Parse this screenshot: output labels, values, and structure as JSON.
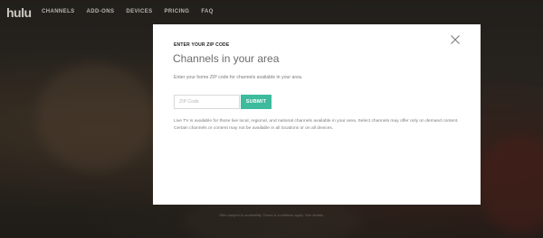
{
  "nav": {
    "logo": "hulu",
    "links": [
      "CHANNELS",
      "ADD-ONS",
      "DEVICES",
      "PRICING",
      "FAQ"
    ]
  },
  "modal": {
    "eyebrow": "ENTER YOUR ZIP CODE",
    "title": "Channels in your area",
    "subtitle": "Enter your home ZIP code for channels available in your area.",
    "zip_placeholder": "ZIP Code",
    "submit_label": "SUBMIT",
    "note": "Live TV is available for those live local, regional, and national channels available in your area. Select channels may offer only on demand content. Certain channels or content may not be available in all locations or on all devices.",
    "close_icon": "close-icon"
  },
  "footer": {
    "note": "Offer subject to availability. Terms & conditions apply. See details."
  },
  "colors": {
    "accent": "#3dbb9c",
    "modal_bg": "#ffffff"
  }
}
